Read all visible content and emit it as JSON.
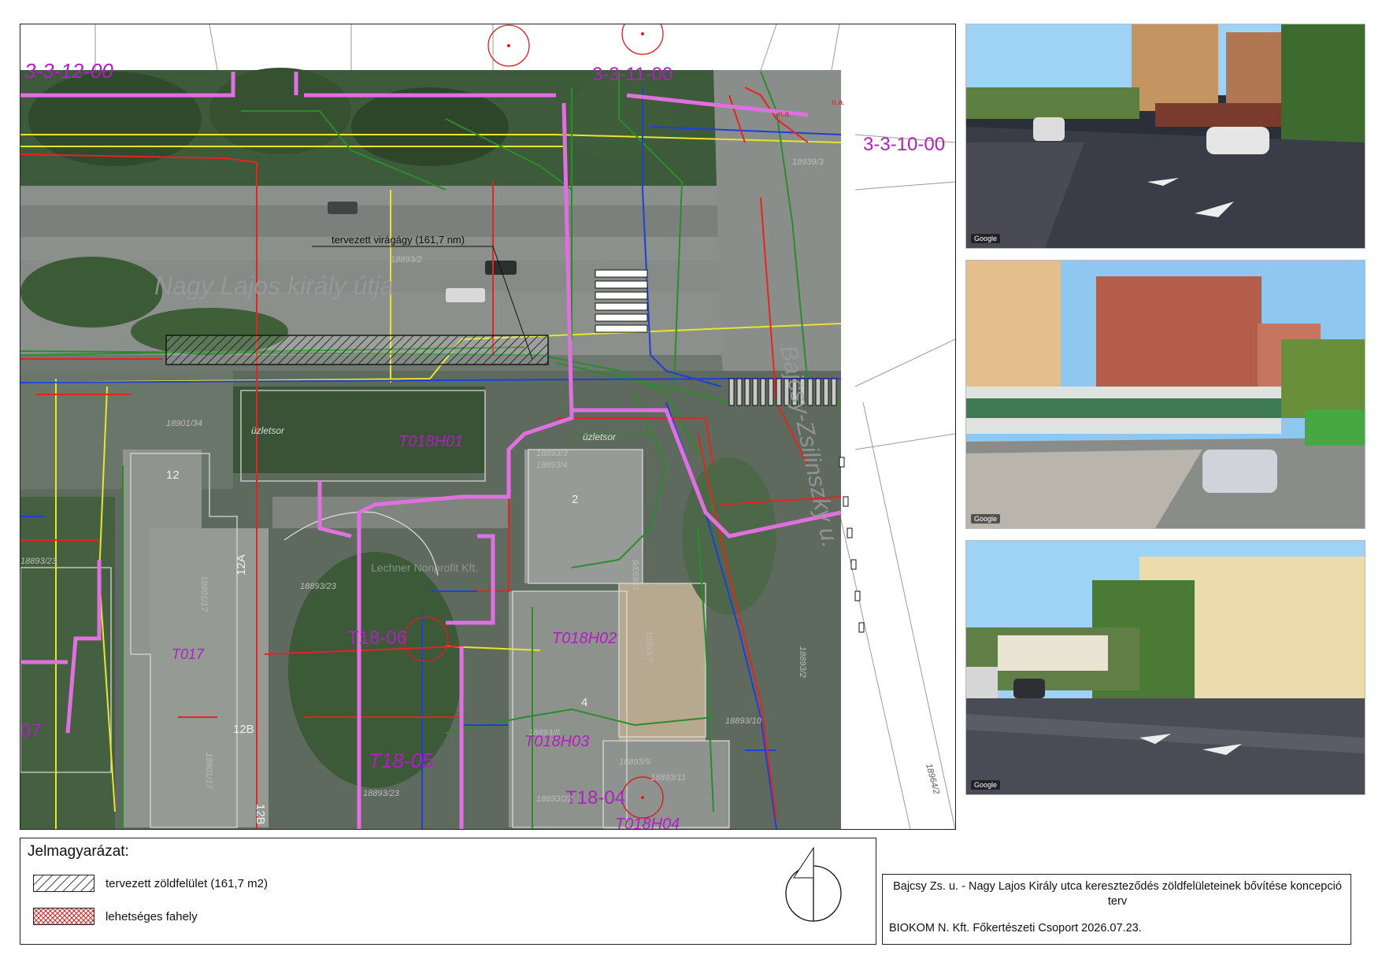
{
  "map": {
    "block_codes": [
      "3-3-12-00",
      "3-3-11-00",
      "3-3-10-00"
    ],
    "street_names": {
      "main": "Nagy Lajos király útja",
      "cross": "Bajcsy-Zsilinszky u."
    },
    "callout": "tervezett virágágy (161,7 nm)",
    "stations": [
      "T018H01",
      "T018H02",
      "T018H03",
      "T018H04",
      "T017"
    ],
    "substations": [
      "T18-06",
      "T18-05",
      "T18-04"
    ],
    "shop_labels": [
      "üzletsor",
      "üzletsor"
    ],
    "parcel_labels": [
      "18939/3",
      "18893/2",
      "18901/34",
      "18893/23",
      "18893/23",
      "18893/4",
      "18893/6",
      "18893/7",
      "18893/8",
      "18893/9",
      "18893/11",
      "18893/10",
      "18893/2",
      "18964/2",
      "18893/23",
      "18893/22",
      "18901/17",
      "18901/17",
      "18893/3"
    ],
    "building_numbers": [
      "2",
      "4",
      "12",
      "12A",
      "12B",
      "12B"
    ],
    "misc_labels": [
      "n.a.",
      "n.a.",
      "07",
      "Lechner Nonprofit Kft."
    ]
  },
  "photos": [
    {
      "caption": "Google"
    },
    {
      "caption": "Google"
    },
    {
      "caption": "Google"
    }
  ],
  "legend": {
    "title": "Jelmagyarázat:",
    "items": [
      {
        "label": "tervezett zöldfelület (161,7 m2)",
        "pattern": "diagonal-hatch"
      },
      {
        "label": "lehetséges fahely",
        "pattern": "red-crosshatch"
      }
    ]
  },
  "title_block": {
    "project": "Bajcsy Zs. u. - Nagy Lajos Király utca kereszteződés zöldfelületeinek bővítése koncepció terv",
    "company_line": "BIOKOM N. Kft. Főkertészeti Csoport  2026.07.23."
  },
  "colors": {
    "gas": "#e8231f",
    "water": "#1f3fd8",
    "electric": "#e070e0",
    "comms": "#2a8c2a",
    "lighting": "#e0e020",
    "block_code": "#b020c0"
  }
}
